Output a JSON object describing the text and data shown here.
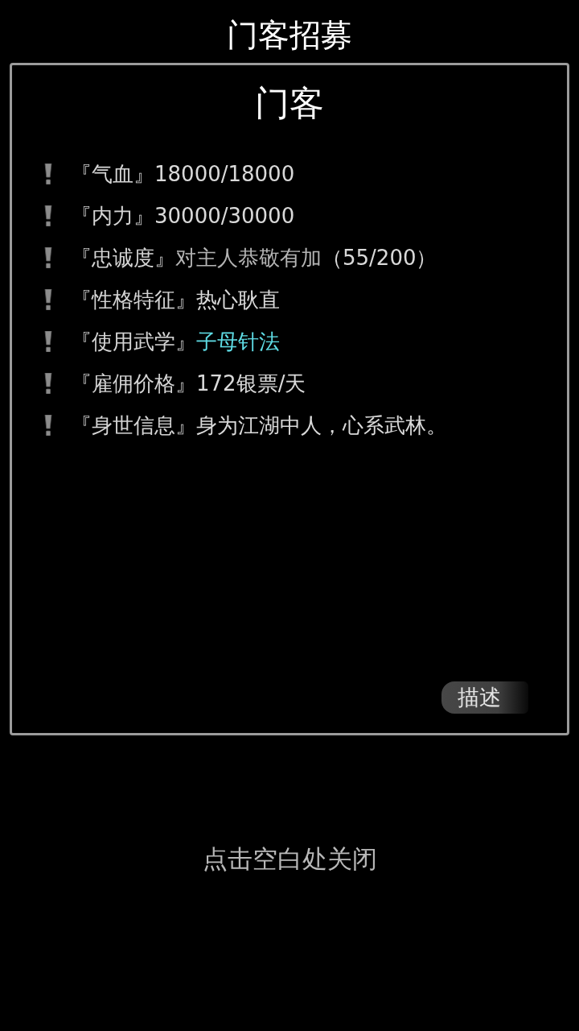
{
  "header": {
    "title": "门客招募"
  },
  "dialog": {
    "title": "门客",
    "attributes": [
      {
        "label": "『气血』",
        "value": "18000/18000",
        "kind": "text"
      },
      {
        "label": "『内力』",
        "value": "30000/30000",
        "kind": "text"
      },
      {
        "label": "『忠诚度』",
        "value": "对主人恭敬有加",
        "note": "（55/200）",
        "kind": "muted"
      },
      {
        "label": "『性格特征』",
        "value": "热心耿直",
        "kind": "text"
      },
      {
        "label": "『使用武学』",
        "value": "子母针法",
        "kind": "skill"
      },
      {
        "label": "『雇佣价格』",
        "value": "172银票/天",
        "kind": "text"
      },
      {
        "label": "『身世信息』",
        "value": "身为江湖中人，心系武林。",
        "kind": "text"
      }
    ],
    "description_button": "描述"
  },
  "close_hint": "点击空白处关闭"
}
